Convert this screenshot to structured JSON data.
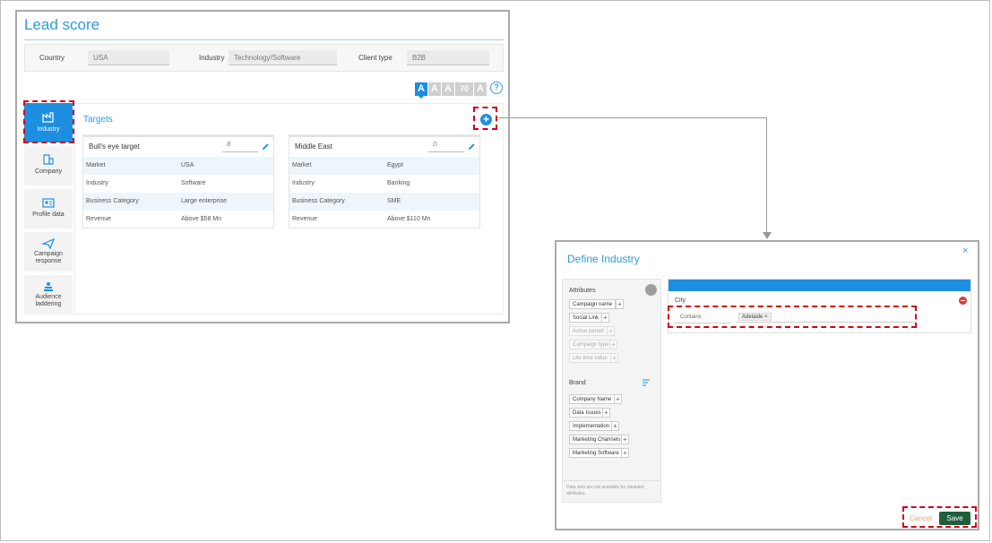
{
  "lead_score": {
    "title": "Lead score",
    "filters": [
      {
        "label": "Country",
        "value": "USA"
      },
      {
        "label": "Industry",
        "value": "Technology/Software"
      },
      {
        "label": "Client type",
        "value": "B2B"
      }
    ],
    "font_sizes": [
      "A",
      "A",
      "A",
      "70",
      "A"
    ],
    "help_glyph": "?",
    "nav": [
      {
        "label": "Industry",
        "icon": "industry-icon",
        "active": true
      },
      {
        "label": "Company",
        "icon": "building-icon",
        "active": false
      },
      {
        "label": "Profile data",
        "icon": "id-card-icon",
        "active": false
      },
      {
        "label": "Campaign response",
        "icon": "paper-plane-icon",
        "active": false
      },
      {
        "label": "Audience laddering",
        "icon": "user-stack-icon",
        "active": false
      }
    ],
    "targets": {
      "title": "Targets",
      "add_glyph": "+",
      "cards": [
        {
          "name": "Bull's eye target",
          "grade": "B",
          "rows": [
            {
              "key": "Market",
              "value": "USA"
            },
            {
              "key": "Industry",
              "value": "Software"
            },
            {
              "key": "Business Category",
              "value": "Large enterprise"
            },
            {
              "key": "Revenue",
              "value": "Above $58 Mn"
            }
          ]
        },
        {
          "name": "Middle East",
          "grade": "D",
          "rows": [
            {
              "key": "Market",
              "value": "Egypt"
            },
            {
              "key": "Industry",
              "value": "Banking"
            },
            {
              "key": "Business Category",
              "value": "SME"
            },
            {
              "key": "Revenue",
              "value": "Above $110 Mn"
            }
          ]
        }
      ]
    }
  },
  "define_industry": {
    "title": "Define Industry",
    "close_glyph": "×",
    "attributes": {
      "title": "Attributes",
      "items": [
        {
          "label": "Campaign name",
          "enabled": true
        },
        {
          "label": "Social Link",
          "enabled": true
        },
        {
          "label": "Active period",
          "enabled": false
        },
        {
          "label": "Campaign type",
          "enabled": false
        },
        {
          "label": "Life time value",
          "enabled": false
        }
      ]
    },
    "brand": {
      "title": "Brand",
      "items": [
        {
          "label": "Company Name"
        },
        {
          "label": "Data Issues"
        },
        {
          "label": "Implementation"
        },
        {
          "label": "Marketing Channels"
        },
        {
          "label": "Marketing Software"
        }
      ]
    },
    "footnote": "Data sets are not available for disabled attributes.",
    "rule": {
      "field": "City",
      "operator": "Contains",
      "tag": "Adelaide ×"
    },
    "cancel_label": "Cancel",
    "save_label": "Save"
  },
  "colors": {
    "accent": "#1d8fe1",
    "title": "#2f9bd8",
    "highlight": "#d0021b",
    "save": "#1f5f3b"
  }
}
